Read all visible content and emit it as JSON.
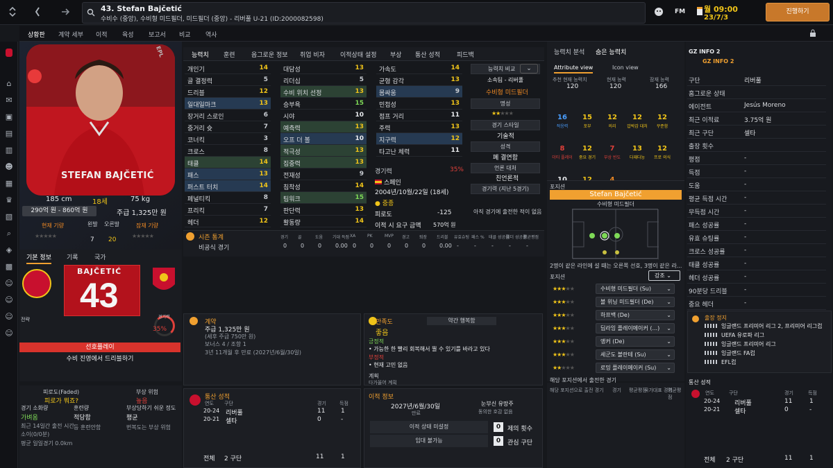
{
  "window": {
    "back_icon": "chevron-left-icon",
    "fwd_icon": "arrow-right-icon"
  },
  "title": {
    "name": "43. Stefan Bajčetić",
    "sub": "수비수 (중앙), 수비형 미드필더, 미드필더 (중앙) - 리버풀 U-21 (ID:2000082598)",
    "fm": "FM",
    "time": "월 09:00",
    "date": "23/7/3",
    "continue": "진행하기"
  },
  "subnav": [
    "상황판",
    "계약 세부",
    "이적",
    "육성",
    "보고서",
    "비교",
    "역사"
  ],
  "profile": {
    "height": "185 cm",
    "age": "18세",
    "weight": "75 kg",
    "value": "290억 원 - 860억 원",
    "wage": "주급 1,325만 원",
    "current_ability": "현재 기량",
    "potential_ability": "잠재 기량",
    "left_foot": "왼발",
    "left_foot_val": "7",
    "right_foot": "오른발",
    "right_foot_val": "20",
    "shirt_name": "STEFAN BAJČETIĆ",
    "epl": "EPL"
  },
  "kit": {
    "tabs": [
      "기본 정보",
      "기록",
      "국가"
    ],
    "name": "BAJČETIĆ",
    "number": "43",
    "rating_label": "경기력",
    "rating": "35%",
    "pos_label": "선호플레이",
    "role": "수비 진영에서 드리블하기"
  },
  "condition": {
    "fatigue_label": "피로도(Faded)",
    "fatigue": "피로가 뭐죠?",
    "injury_label": "부상 위험",
    "injury": "높음",
    "match_fit_label": "경기 소화량",
    "match_fit": "가벼움",
    "training_label": "훈련량",
    "training": "적당함",
    "injury_prone_label": "부상당하기 쉬운 정도",
    "injury_prone": "평균",
    "min_label": "최근 14일간 출전 시간",
    "min_val": "소이(0/0분)",
    "extra1": "등 훈련안함",
    "extra2": "번복도는 부상 위험",
    "dist": "평균 일일경기 0.0km"
  },
  "tabs": [
    "능력치",
    "훈련",
    "옵그로운 정보",
    "취업 비자",
    "이적상태 설정",
    "부상",
    "통산 성적",
    "피드백"
  ],
  "attrs_col1": [
    {
      "n": "개인기",
      "v": "14"
    },
    {
      "n": "골 결정력",
      "v": "5"
    },
    {
      "n": "드리블",
      "v": "12"
    },
    {
      "n": "일대일마크",
      "v": "13"
    },
    {
      "n": "장거리 스로인",
      "v": "6"
    },
    {
      "n": "중거리 슛",
      "v": "7"
    },
    {
      "n": "코너킥",
      "v": "3"
    },
    {
      "n": "크로스",
      "v": "8"
    },
    {
      "n": "태클",
      "v": "14"
    },
    {
      "n": "패스",
      "v": "13"
    },
    {
      "n": "퍼스트 터치",
      "v": "14"
    },
    {
      "n": "페널티킥",
      "v": "8"
    },
    {
      "n": "프리킥",
      "v": "7"
    },
    {
      "n": "헤더",
      "v": "12"
    }
  ],
  "attrs_col2": [
    {
      "n": "대담성",
      "v": "13"
    },
    {
      "n": "리더십",
      "v": "5"
    },
    {
      "n": "수비 위치 선정",
      "v": "13"
    },
    {
      "n": "승부욕",
      "v": "15"
    },
    {
      "n": "시야",
      "v": "10"
    },
    {
      "n": "예측력",
      "v": "13"
    },
    {
      "n": "오프 더 볼",
      "v": "10"
    },
    {
      "n": "적극성",
      "v": "13"
    },
    {
      "n": "집중력",
      "v": "13"
    },
    {
      "n": "전재성",
      "v": "9"
    },
    {
      "n": "침착성",
      "v": "14"
    },
    {
      "n": "팀워크",
      "v": "15"
    },
    {
      "n": "판단력",
      "v": "13"
    },
    {
      "n": "활동량",
      "v": "14"
    }
  ],
  "attrs_col3": [
    {
      "n": "가속도",
      "v": "14"
    },
    {
      "n": "균형 감각",
      "v": "13"
    },
    {
      "n": "몸싸움",
      "v": "9"
    },
    {
      "n": "민첩성",
      "v": "13"
    },
    {
      "n": "점프 거리",
      "v": "11"
    },
    {
      "n": "주력",
      "v": "13"
    },
    {
      "n": "지구력",
      "v": "12"
    },
    {
      "n": "타고난 체력",
      "v": "11"
    }
  ],
  "side_info": {
    "compare": "능력치 비교",
    "club": "소속팀 - 리버풀",
    "position": "수비형 미드필더",
    "rep": "명성",
    "style": "경기 스타일",
    "skill": "기술적",
    "personality": "성격",
    "pers_val": "폐 결연함",
    "media": "언론 대처",
    "media_val": "친언론적",
    "recent": "경기력 (지난 5경기)",
    "no_recent": "아직 경기에 출전한 적이 없음"
  },
  "basic": {
    "form_label": "경기력",
    "form_pct": "35%",
    "nation": "스페인",
    "dob": "2004년/10월/22일 (18세)",
    "status": "중종",
    "wage_l": "피로도",
    "wage_v": "-125",
    "contract_l": "이적 시 요구 금액",
    "contract_v": "570억 원"
  },
  "season": {
    "title": "시즌 통계",
    "cols": [
      "경기",
      "골",
      "도움",
      "기대 득점",
      "XA",
      "PK",
      "MVP",
      "경고",
      "퇴장",
      "드리블",
      "유효슈팅",
      "패스 %",
      "태클 성공률",
      "헤더 성공률",
      "평균평점"
    ],
    "row_label": "비공식 경기",
    "row_vals": [
      "0",
      "0",
      "0",
      "0.00",
      "0",
      "0",
      "0",
      "0",
      "0",
      "0.00",
      "-",
      "-",
      "-",
      "-",
      "-"
    ]
  },
  "contract": {
    "title": "계약",
    "wage": "주급 1,325만 원",
    "sub1": "(세후 주급 750만 원)",
    "sub2": "보너스 4 / 조항 1",
    "sub3": "3년 11개월 후 만료 (2027년/6월/30일)"
  },
  "morale": {
    "title": "만족도",
    "val_label": "약간 행복함",
    "status": "좋음",
    "pos_label": "긍정적",
    "pos_text": "가능한 한 빨리 회복해서 뛸 수 있기를 바라고 있다",
    "neg_label": "부정적",
    "neg_text": "현재 고민 없음",
    "plan_label": "계획",
    "plan_text": "다가올어 계획"
  },
  "career": {
    "title": "통산 성적",
    "cols": [
      "연도",
      "구단",
      "경기",
      "득점"
    ],
    "rows": [
      {
        "y": "20-24",
        "c": "리버풀",
        "g": "11",
        "s": "1"
      },
      {
        "y": "20-21",
        "c": "셀타",
        "g": "0",
        "s": "-"
      }
    ],
    "total_label": "전체",
    "total_clubs": "2 구단",
    "total_g": "11",
    "total_s": "1"
  },
  "transfer": {
    "title": "이적 정보",
    "date": "2027년/6월/30일",
    "date_l": "만료",
    "loan": "눈부신 유망주",
    "loan2": "동의한 호감 없음",
    "status": "이적 상태 미설정",
    "loan_status": "임대 불가능",
    "offers": "0",
    "offers_l": "제의 횟수",
    "interest": "0",
    "interest_l": "관심 구단"
  },
  "analysis": {
    "tabs": [
      "능력치 분석",
      "숨은 능력치"
    ],
    "views": [
      "Attribute view",
      "Icon view"
    ],
    "ca_l": "추천 현재 능력치",
    "ca": "120",
    "pa_l": "현재 능력",
    "pa": "120",
    "pot_l": "잠재 능력",
    "pot": "166",
    "icons": [
      {
        "v": "16",
        "l": "적응력",
        "c": "b"
      },
      {
        "v": "15",
        "l": "포부",
        "c": "y"
      },
      {
        "v": "12",
        "l": "의리",
        "c": "y"
      },
      {
        "v": "12",
        "l": "압박감 대처",
        "c": "y"
      },
      {
        "v": "12",
        "l": "꾸준함",
        "c": "y"
      },
      {
        "v": "8",
        "l": "더티 플레이",
        "c": "r"
      },
      {
        "v": "12",
        "l": "중요 경기",
        "c": "y"
      },
      {
        "v": "7",
        "l": "부상 빈도",
        "c": "r"
      },
      {
        "v": "13",
        "l": "다재다능",
        "c": "y"
      },
      {
        "v": "12",
        "l": "프로 의식",
        "c": "y"
      },
      {
        "v": "10",
        "l": "스포츠맨십",
        "c": "w"
      },
      {
        "v": "12",
        "l": "침착성",
        "c": "y"
      },
      {
        "v": "4",
        "l": "논쟁성",
        "c": "o"
      }
    ]
  },
  "positions": {
    "title": "포지션",
    "name": "Stefan Bajčetić",
    "role": "수비형 미드필더",
    "note": "2명이 같은 라인에 설 때는 오른쪽 선호, 3명이 같은 라...",
    "label": "포지션",
    "filter": "강조",
    "list": [
      {
        "n": "수비형 미드필더 (Su)",
        "s": 3
      },
      {
        "n": "볼 위닝 미드필더 (De)",
        "s": 3
      },
      {
        "n": "하프백 (De)",
        "s": 3
      },
      {
        "n": "딥라잉 플레이메이커 (...)",
        "s": 3
      },
      {
        "n": "앵커 (De)",
        "s": 3
      },
      {
        "n": "세군도 볼란테 (Su)",
        "s": 3
      },
      {
        "n": "로밍 플레이메이커 (Su)",
        "s": 2
      }
    ],
    "bottom_l": "해당 포지션에서 출전한 경기",
    "bottom_sub": "해당 포지션으로 출전 경기",
    "bottom_cols": [
      "경기",
      "평균평점",
      "국가대표 경기",
      "평균평점"
    ]
  },
  "gz": {
    "title": "GZ INFO 2",
    "sub": "GZ INFO 2",
    "rows": [
      {
        "k": "구단",
        "v": "리버풀"
      },
      {
        "k": "홈그로운 상태",
        "v": ""
      },
      {
        "k": "에이전트",
        "v": "Jesús Moreno"
      },
      {
        "k": "최근 이적료",
        "v": "3.75억 원"
      },
      {
        "k": "최근 구단",
        "v": "셀타"
      },
      {
        "k": "출장 횟수",
        "v": ""
      },
      {
        "k": "평점",
        "v": "-"
      },
      {
        "k": "득점",
        "v": "-"
      },
      {
        "k": "도움",
        "v": "-"
      },
      {
        "k": "평균 득점 시간",
        "v": "-"
      },
      {
        "k": "무득점 시간",
        "v": "-"
      },
      {
        "k": "패스 성공률",
        "v": "-"
      },
      {
        "k": "유효 슈팅률",
        "v": "-"
      },
      {
        "k": "크로스 성공률",
        "v": "-"
      },
      {
        "k": "태클 성공률",
        "v": "-"
      },
      {
        "k": "헤더 성공률",
        "v": "-"
      },
      {
        "k": "90분당 드리블",
        "v": "-"
      },
      {
        "k": "중요 헤더",
        "v": "-"
      },
      {
        "k": "중요 태클",
        "v": "-"
      }
    ],
    "comp_title": "출장 정지",
    "comps": [
      "잉글랜드 프리미어 리그 2, 프리미어 리그컵",
      "UEFA 유로파 리그",
      "잉글랜드 프리미어 리그",
      "잉글랜드 FA컵",
      "EFL컵"
    ],
    "career_title": "통산 성적",
    "career_cols": [
      "연도",
      "구단",
      "경기",
      "득점"
    ],
    "career_rows": [
      {
        "y": "20-24",
        "c": "리버풀",
        "g": "11",
        "s": "1"
      },
      {
        "y": "20-21",
        "c": "셀타",
        "g": "0",
        "s": "-"
      }
    ],
    "total_label": "전체",
    "total_clubs": "2 구단",
    "total_g": "11",
    "total_s": "1"
  }
}
